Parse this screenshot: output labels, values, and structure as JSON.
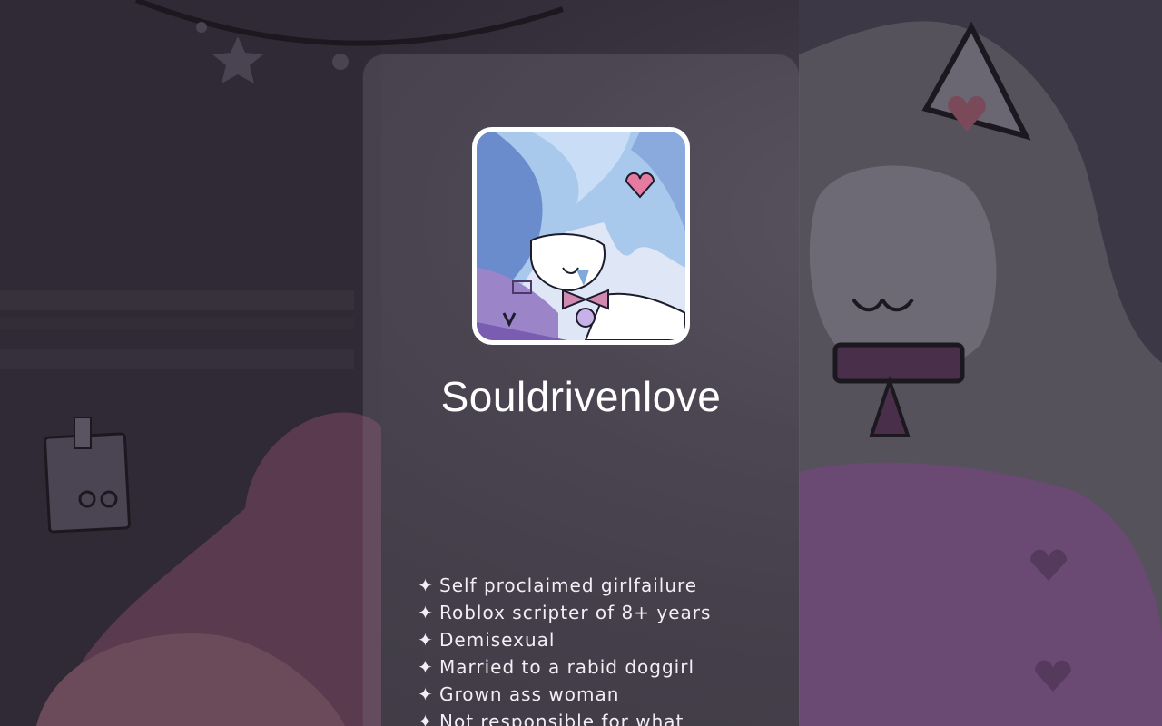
{
  "profile": {
    "name": "Souldrivenlove",
    "avatar_icon": "anime-girl-avatar"
  },
  "bio": {
    "bullet": "✦",
    "lines": [
      "Self proclaimed girlfailure",
      "Roblox scripter of 8+ years",
      "Demisexual",
      "Married to a rabid doggirl",
      "Grown ass woman",
      "Not responsible for what"
    ]
  },
  "colors": {
    "background": "#2a2530",
    "card": "rgba(120,116,128,0.32)",
    "text": "#ffffff",
    "avatar_border": "#ffffff"
  }
}
